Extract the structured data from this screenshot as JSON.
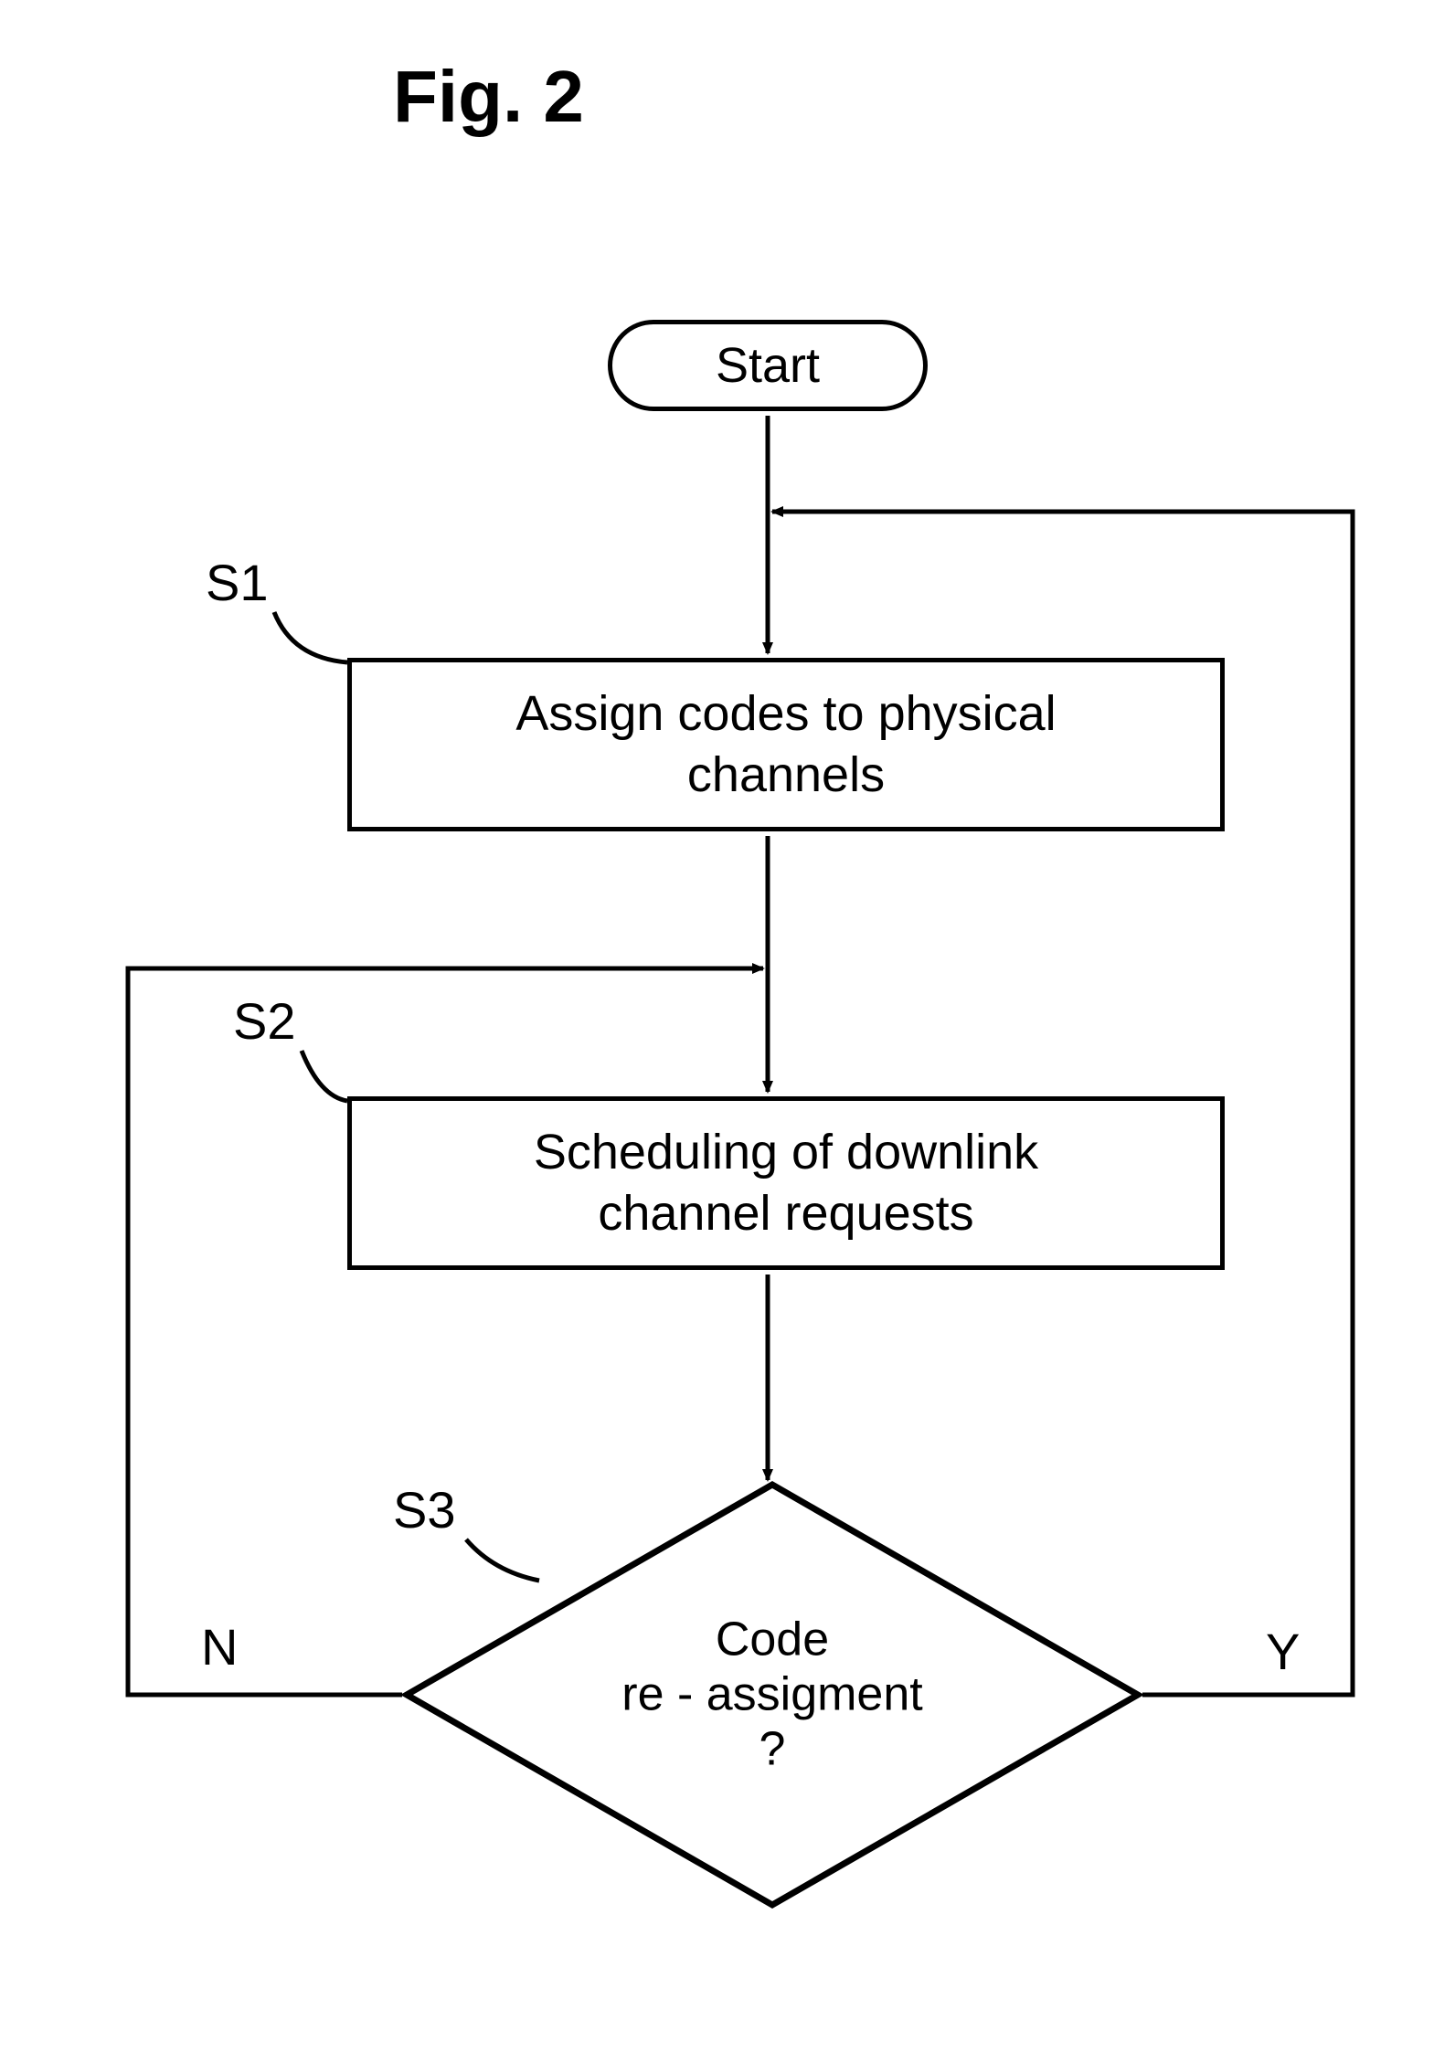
{
  "figure": {
    "title": "Fig. 2"
  },
  "nodes": {
    "start": {
      "label": "Start"
    },
    "s1": {
      "text": "Assign codes to physical\nchannels"
    },
    "s2": {
      "text": "Scheduling of downlink\nchannel  requests"
    },
    "s3": {
      "text": "Code\nre - assigment\n?"
    }
  },
  "step_labels": {
    "s1": "S1",
    "s2": "S2",
    "s3": "S3"
  },
  "branches": {
    "yes": "Y",
    "no": "N"
  },
  "chart_data": {
    "type": "flowchart",
    "nodes": [
      {
        "id": "start",
        "type": "terminator",
        "label": "Start"
      },
      {
        "id": "S1",
        "type": "process",
        "label": "Assign codes to physical channels"
      },
      {
        "id": "S2",
        "type": "process",
        "label": "Scheduling of downlink channel requests"
      },
      {
        "id": "S3",
        "type": "decision",
        "label": "Code re-assigment ?"
      }
    ],
    "edges": [
      {
        "from": "start",
        "to": "S1"
      },
      {
        "from": "S1",
        "to": "S2"
      },
      {
        "from": "S2",
        "to": "S3"
      },
      {
        "from": "S3",
        "to": "S1",
        "label": "Y"
      },
      {
        "from": "S3",
        "to": "S2",
        "label": "N"
      }
    ]
  }
}
